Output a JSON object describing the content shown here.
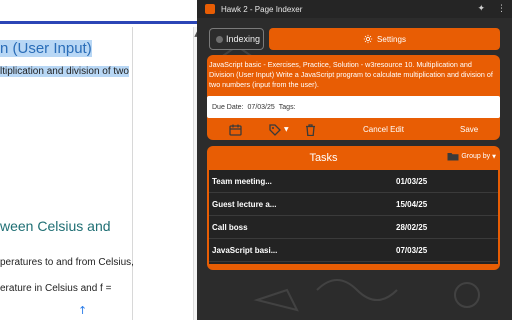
{
  "webpage": {
    "heading_fragment": "n (User Input)",
    "line1": "ltiplication and division of two",
    "heading2_fragment": "ween Celsius and",
    "line2": "peratures to and from Celsius,",
    "line3": "erature in Celsius and f =",
    "scroll_up_icon": "arrow-up-icon"
  },
  "panel": {
    "window_title": "Hawk 2 - Page Indexer",
    "indexing_label": "Indexing",
    "settings_label": "Settings",
    "note": {
      "description": "JavaScript basic - Exercises, Practice, Solution - w3resource 10. Multiplication and Division (User Input)  Write a JavaScript program to calculate multiplication and division of two numbers (input from the user).",
      "due_label": "Due Date:",
      "due_value": "07/03/25",
      "tags_label": "Tags:",
      "cancel_label": "Cancel Edit",
      "save_label": "Save"
    },
    "tasks": {
      "title": "Tasks",
      "group_by_label": "Group by",
      "rows": [
        {
          "name": "Team meeting...",
          "date": "01/03/25"
        },
        {
          "name": "Guest lecture a...",
          "date": "15/04/25"
        },
        {
          "name": "Call boss",
          "date": "28/02/25"
        },
        {
          "name": "JavaScript basi...",
          "date": "07/03/25"
        }
      ]
    }
  },
  "colors": {
    "accent": "#e85d04",
    "panel_bg": "#2c2c2c",
    "link_blue": "#2a6db8",
    "selection": "#b8d7f5"
  }
}
